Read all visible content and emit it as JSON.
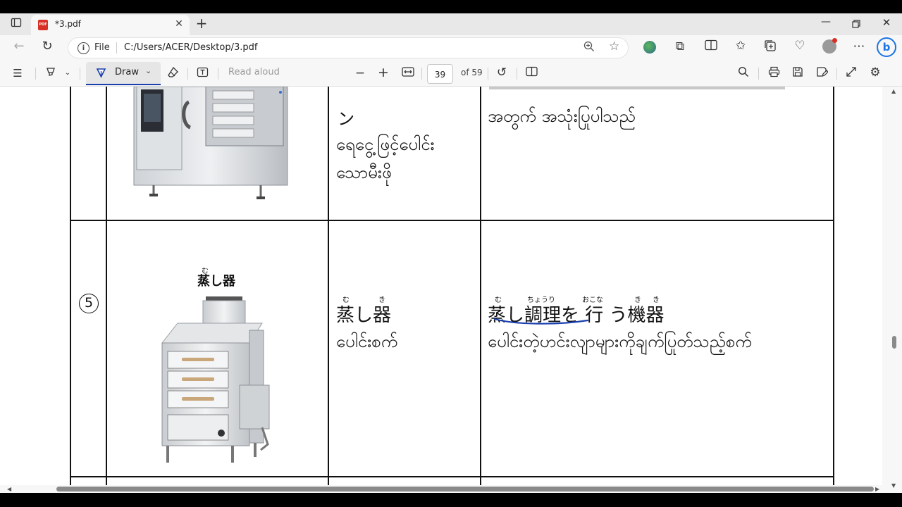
{
  "browser": {
    "tab_title": "*3.pdf",
    "tab_badge": "PDF",
    "new_tab": "+",
    "address_scheme": "File",
    "address_url": "C:/Users/ACER/Desktop/3.pdf"
  },
  "pdf_toolbar": {
    "draw_label": "Draw",
    "read_aloud_label": "Read aloud",
    "zoom_out": "−",
    "zoom_in": "+",
    "page_number": "39",
    "page_total": "of 59"
  },
  "document": {
    "row4": {
      "name_jp_tail": "ン",
      "name_mm_line1": "ရေငွေ့ဖြင့်ပေါင်း",
      "name_mm_line2": "သောမီးဖို",
      "desc_mm": "အတွက် အသုံးပြုပါသည်"
    },
    "row5": {
      "number": "5",
      "image_caption": "蒸し器",
      "name_jp": "蒸し器",
      "name_jp_ruby": [
        "む",
        "き"
      ],
      "name_mm": "ပေါင်းစက်",
      "desc_jp": "蒸し調理を 行 う機器",
      "desc_jp_ruby": [
        "む",
        "ちょうり",
        "おこな",
        "き",
        "き"
      ],
      "desc_mm": "ပေါင်းတဲ့ဟင်းလျာများကိုချက်ပြုတ်သည့်စက်"
    }
  },
  "colors": {
    "annotation_underline": "#1a3fae",
    "table_lines": "#111111",
    "page_background": "#ffffff"
  }
}
